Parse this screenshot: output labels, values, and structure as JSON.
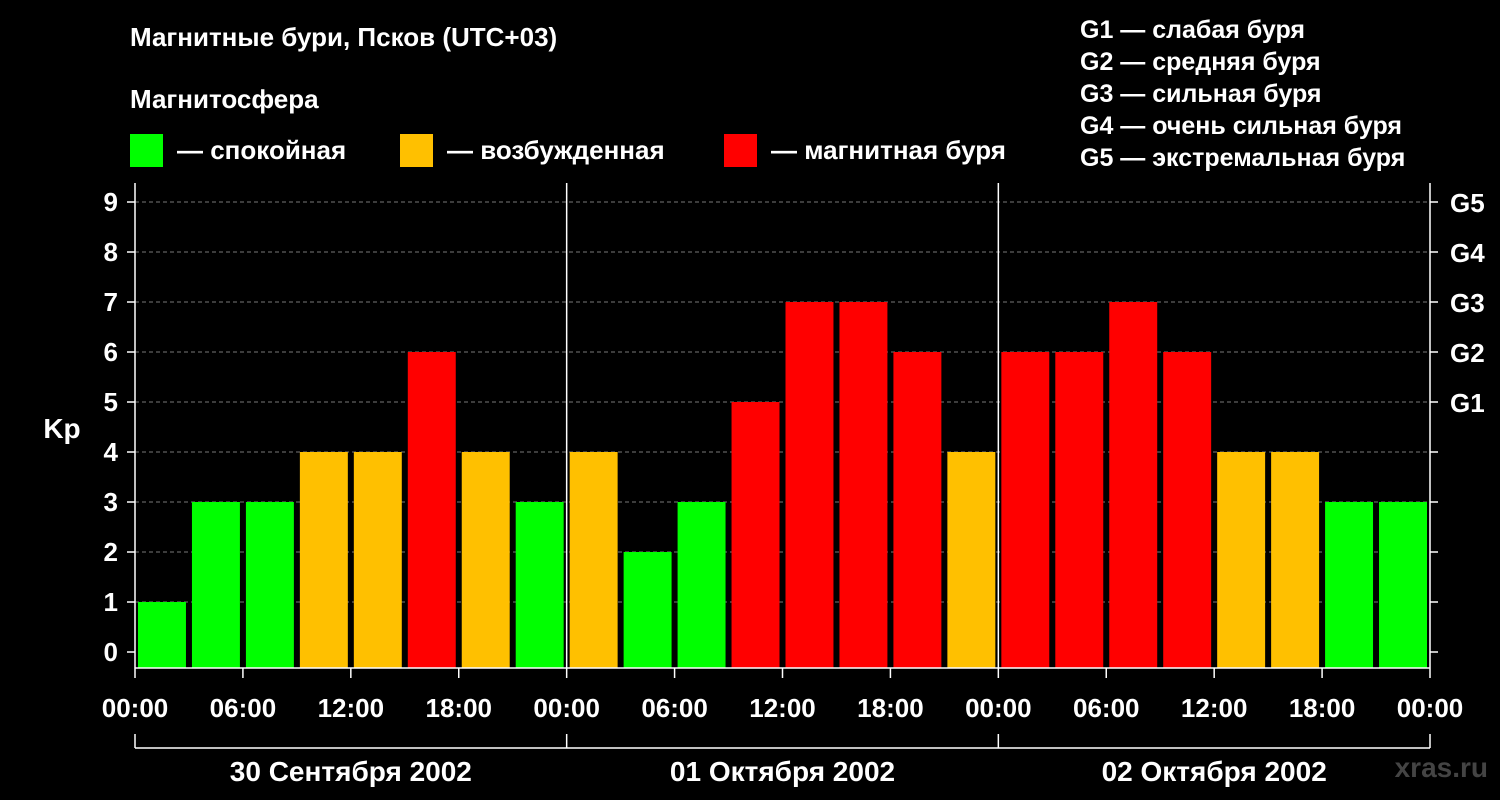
{
  "title": "Магнитные бури, Псков (UTC+03)",
  "subtitle": "Магнитосфера",
  "legend": [
    {
      "label": "— спокойная",
      "color": "#00ff00"
    },
    {
      "label": "— возбужденная",
      "color": "#ffc000"
    },
    {
      "label": "— магнитная буря",
      "color": "#ff0000"
    }
  ],
  "g_scale": [
    "G1 — слабая буря",
    "G2 — средняя буря",
    "G3 — сильная буря",
    "G4 — очень сильная буря",
    "G5 — экстремальная буря"
  ],
  "credit": "xras.ru",
  "chart_data": {
    "type": "bar",
    "ylabel": "Kp",
    "ylim": [
      0,
      9
    ],
    "y_ticks": [
      "0",
      "1",
      "2",
      "3",
      "4",
      "5",
      "6",
      "7",
      "8",
      "9"
    ],
    "right_ticks": [
      {
        "value": 5,
        "label": "G1"
      },
      {
        "value": 6,
        "label": "G2"
      },
      {
        "value": 7,
        "label": "G3"
      },
      {
        "value": 8,
        "label": "G4"
      },
      {
        "value": 9,
        "label": "G5"
      }
    ],
    "x_tick_labels": [
      "00:00",
      "06:00",
      "12:00",
      "18:00",
      "00:00",
      "06:00",
      "12:00",
      "18:00",
      "00:00",
      "06:00",
      "12:00",
      "18:00",
      "00:00"
    ],
    "days": [
      "30 Сентября 2002",
      "01 Октября 2002",
      "02 Октября 2002"
    ],
    "colors": {
      "quiet": "#00ff00",
      "active": "#ffc000",
      "storm": "#ff0000"
    },
    "values": [
      1,
      3,
      3,
      4,
      4,
      6,
      4,
      3,
      4,
      2,
      3,
      5,
      7,
      7,
      6,
      4,
      6,
      6,
      7,
      6,
      4,
      4,
      3,
      3
    ],
    "grid": true
  }
}
